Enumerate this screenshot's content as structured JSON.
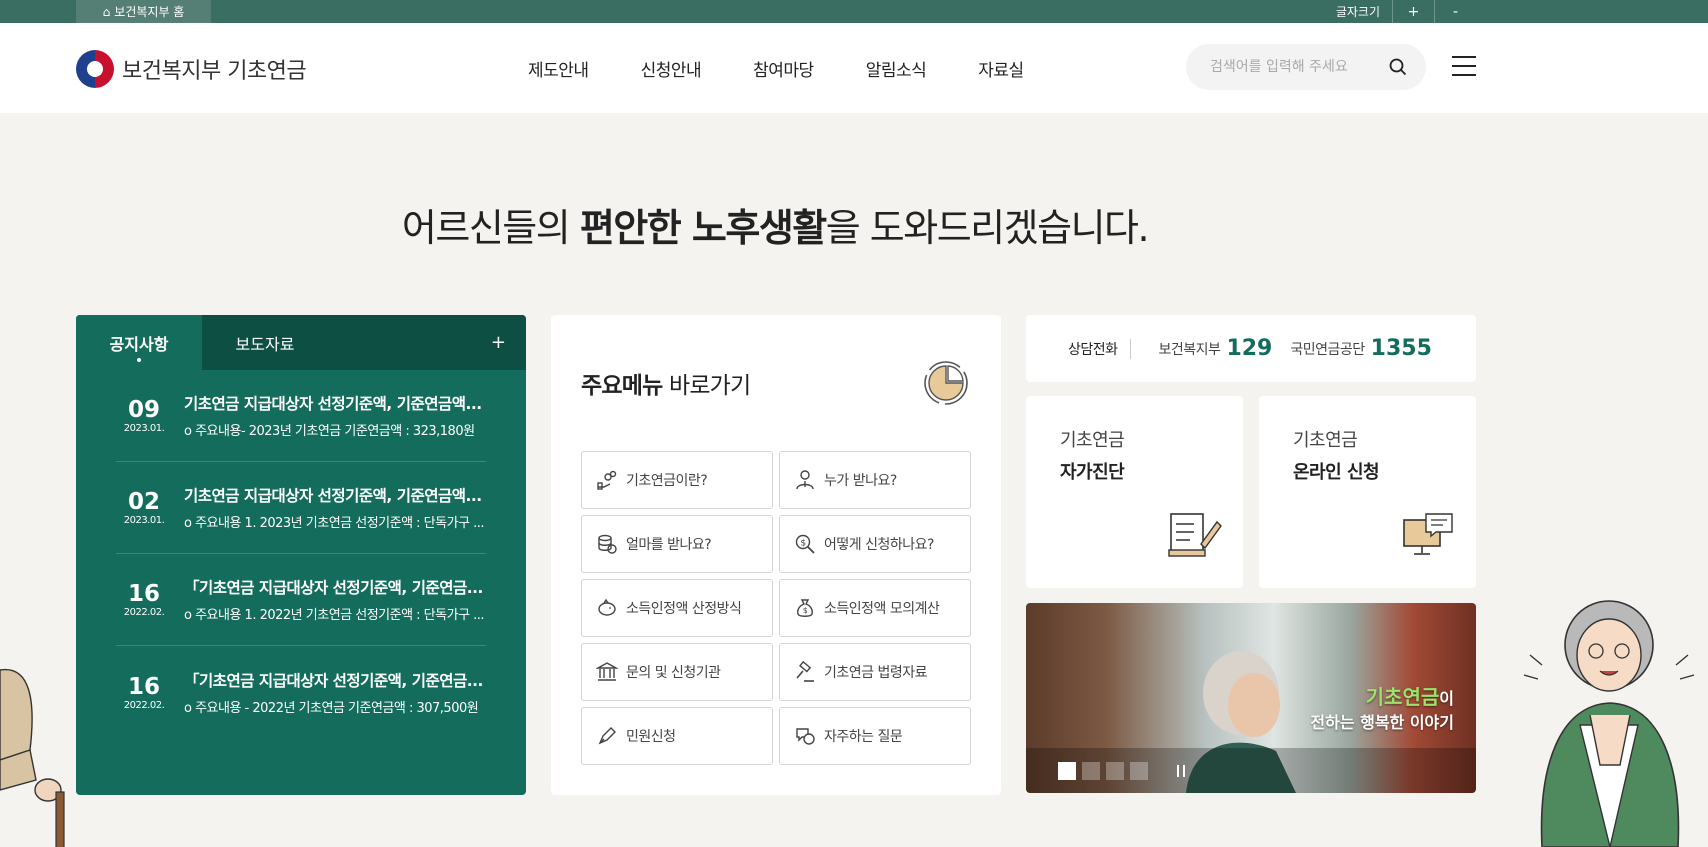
{
  "topbar": {
    "home_label": "보건복지부 홈",
    "zoom_label": "글자크기",
    "zoom_in": "+",
    "zoom_out": "-"
  },
  "header": {
    "logo_text": "보건복지부 기초연금",
    "nav": [
      "제도안내",
      "신청안내",
      "참여마당",
      "알림소식",
      "자료실"
    ],
    "search_placeholder": "검색어를 입력해 주세요"
  },
  "slogan": {
    "pre": "어르신들의 ",
    "bold": "편안한 노후생활",
    "post": "을 도와드리겠습니다."
  },
  "notice": {
    "tabs": [
      "공지사항",
      "보도자료"
    ],
    "more": "+",
    "items": [
      {
        "day": "09",
        "ym": "2023.01.",
        "title": "기초연금 지급대상자 선정기준액, 기준연금액...",
        "sub": "o 주요내용- 2023년 기초연금 기준연금액 : 323,180원"
      },
      {
        "day": "02",
        "ym": "2023.01.",
        "title": "기초연금 지급대상자 선정기준액, 기준연금액...",
        "sub": "o 주요내용 1. 2023년 기초연금 선정기준액 : 단독가구 ..."
      },
      {
        "day": "16",
        "ym": "2022.02.",
        "title": "「기초연금 지급대상자 선정기준액, 기준연금...",
        "sub": "o 주요내용 1. 2022년 기초연금 선정기준액 : 단독가구 ..."
      },
      {
        "day": "16",
        "ym": "2022.02.",
        "title": "「기초연금 지급대상자 선정기준액, 기준연금...",
        "sub": "o 주요내용 - 2022년 기초연금 기준연금액 : 307,500원"
      }
    ]
  },
  "quick": {
    "title_bold": "주요메뉴",
    "title_rest": " 바로가기",
    "items": [
      {
        "label": "기초연금이란?",
        "icon": "coins-hand-icon"
      },
      {
        "label": "누가 받나요?",
        "icon": "person-icon"
      },
      {
        "label": "얼마를 받나요?",
        "icon": "coin-stack-icon"
      },
      {
        "label": "어떻게 신청하나요?",
        "icon": "magnifier-dollar-icon"
      },
      {
        "label": "소득인정액 산정방식",
        "icon": "piggy-bank-icon"
      },
      {
        "label": "소득인정액 모의계산",
        "icon": "money-bag-icon"
      },
      {
        "label": "문의 및 신청기관",
        "icon": "institution-icon"
      },
      {
        "label": "기초연금 법령자료",
        "icon": "gavel-icon"
      },
      {
        "label": "민원신청",
        "icon": "pen-icon"
      },
      {
        "label": "자주하는 질문",
        "icon": "speech-bubble-icon"
      }
    ]
  },
  "call": {
    "label": "상담전화",
    "org1": "보건복지부",
    "num1": "129",
    "org2": "국민연금공단",
    "num2": "1355"
  },
  "cards": [
    {
      "line1": "기초연금",
      "line2": "자가진단",
      "icon": "checklist-icon"
    },
    {
      "line1": "기초연금",
      "line2": "온라인 신청",
      "icon": "computer-icon"
    }
  ],
  "banner": {
    "line1_hl": "기초연금",
    "line1_rest": "이",
    "line2": "전하는 행복한 이야기"
  },
  "colors": {
    "primary": "#136c5c",
    "primary_dark": "#0e4f44",
    "topbar": "#3a6e63",
    "background": "#f4f3ef"
  }
}
